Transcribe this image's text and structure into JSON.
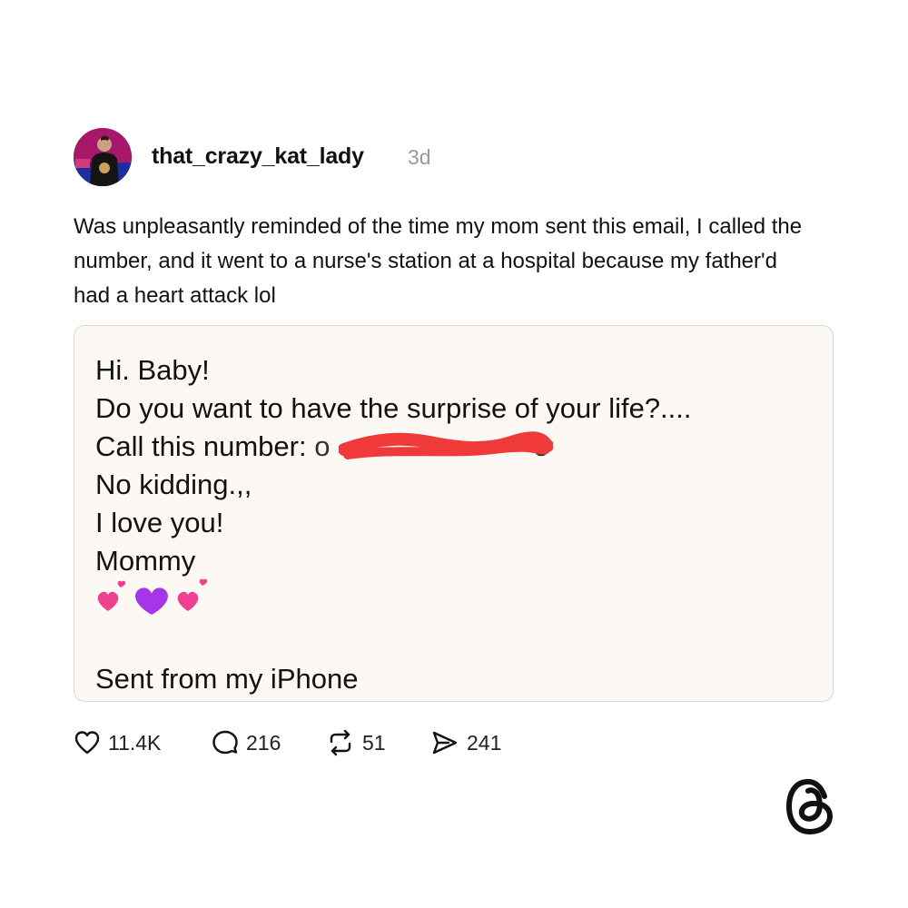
{
  "post": {
    "username": "that_crazy_kat_lady",
    "timestamp": "3d",
    "text": "Was unpleasantly reminded of the time my mom sent this email, I called the number, and it went to a nurse's station at a hospital because my father'd had a heart attack lol"
  },
  "email": {
    "greeting": "Hi. Baby!",
    "line2": "Do you want to have the surprise of your life?....",
    "call_label": "Call this number: ",
    "number_partial": "o                          o",
    "line4": "No kidding.,,",
    "line5": "I love you!",
    "line6": "Mommy",
    "footer": "Sent from my iPhone",
    "redaction_color": "#f03a3a"
  },
  "actions": {
    "likes": "11.4K",
    "replies": "216",
    "reposts": "51",
    "shares": "241"
  },
  "icons": {
    "like": "heart-icon",
    "reply": "comment-icon",
    "repost": "repost-icon",
    "share": "send-icon",
    "brand": "threads-logo-icon"
  }
}
